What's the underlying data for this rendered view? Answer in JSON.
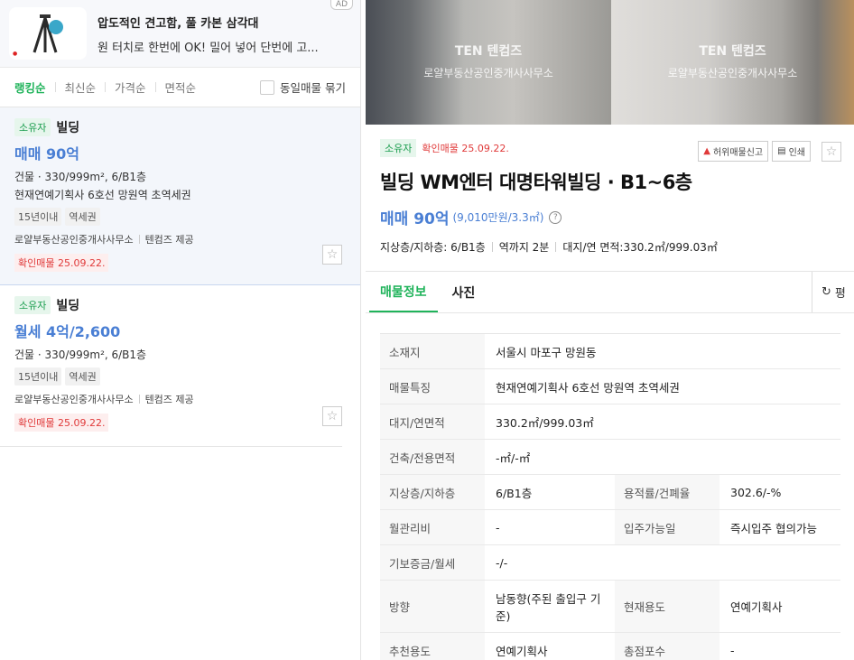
{
  "ad": {
    "tag": "AD",
    "title": "압도적인 견고함, 풀 카본 삼각대",
    "desc": "원 터치로 한번에 OK! 밀어 넣어 단번에 고..."
  },
  "sort": {
    "items": [
      "랭킹순",
      "최신순",
      "가격순",
      "면적순"
    ],
    "group_label": "동일매물 묶기"
  },
  "listings": [
    {
      "owner_tag": "소유자",
      "type": "빌딩",
      "price": "매매 90억",
      "spec": "건물 · 330/999m², 6/B1층",
      "feature": "현재연예기획사 6호선 망원역 초역세권",
      "chips": [
        "15년이내",
        "역세권"
      ],
      "agency": "로얄부동산공인중개사사무소",
      "provider": "텐컴즈 제공",
      "verified": "확인매물 25.09.22."
    },
    {
      "owner_tag": "소유자",
      "type": "빌딩",
      "price": "월세 4억/2,600",
      "spec": "건물 · 330/999m², 6/B1층",
      "feature": "",
      "chips": [
        "15년이내",
        "역세권"
      ],
      "agency": "로얄부동산공인중개사사무소",
      "provider": "텐컴즈 제공",
      "verified": "확인매물 25.09.22."
    }
  ],
  "photos": {
    "watermark_logo": "TEN 텐컴즈",
    "watermark_office": "로얄부동산공인중개사사무소"
  },
  "detail": {
    "owner_tag": "소유자",
    "verified": "확인매물 25.09.22.",
    "report_label": "허위매물신고",
    "print_label": "인쇄",
    "title": "빌딩 WM엔터 대명타워빌딩 · B1~6층",
    "price_main": "매매 90억",
    "price_sub": "(9,010만원/3.3㎡)",
    "summary": [
      "지상층/지하층: 6/B1층",
      "역까지 2분",
      "대지/연 면적:330.2㎡/999.03㎡"
    ],
    "tabs": [
      "매물정보",
      "사진"
    ],
    "side_tab": "평"
  },
  "info": [
    {
      "k1": "소재지",
      "v1": "서울시 마포구 망원동"
    },
    {
      "k1": "매물특징",
      "v1": "현재연예기획사 6호선 망원역 초역세권"
    },
    {
      "k1": "대지/연면적",
      "v1": "330.2㎡/999.03㎡"
    },
    {
      "k1": "건축/전용면적",
      "v1": "-㎡/-㎡"
    },
    {
      "k1": "지상층/지하층",
      "v1": "6/B1층",
      "k2": "용적률/건폐율",
      "v2": "302.6/-%"
    },
    {
      "k1": "월관리비",
      "v1": "-",
      "k2": "입주가능일",
      "v2": "즉시입주 협의가능"
    },
    {
      "k1": "기보증금/월세",
      "v1": "-/-"
    },
    {
      "k1": "방향",
      "v1": "남동향(주된 출입구 기준)",
      "k2": "현재용도",
      "v2": "연예기획사"
    },
    {
      "k1": "추천용도",
      "v1": "연예기획사",
      "k2": "총점포수",
      "v2": "-"
    }
  ]
}
